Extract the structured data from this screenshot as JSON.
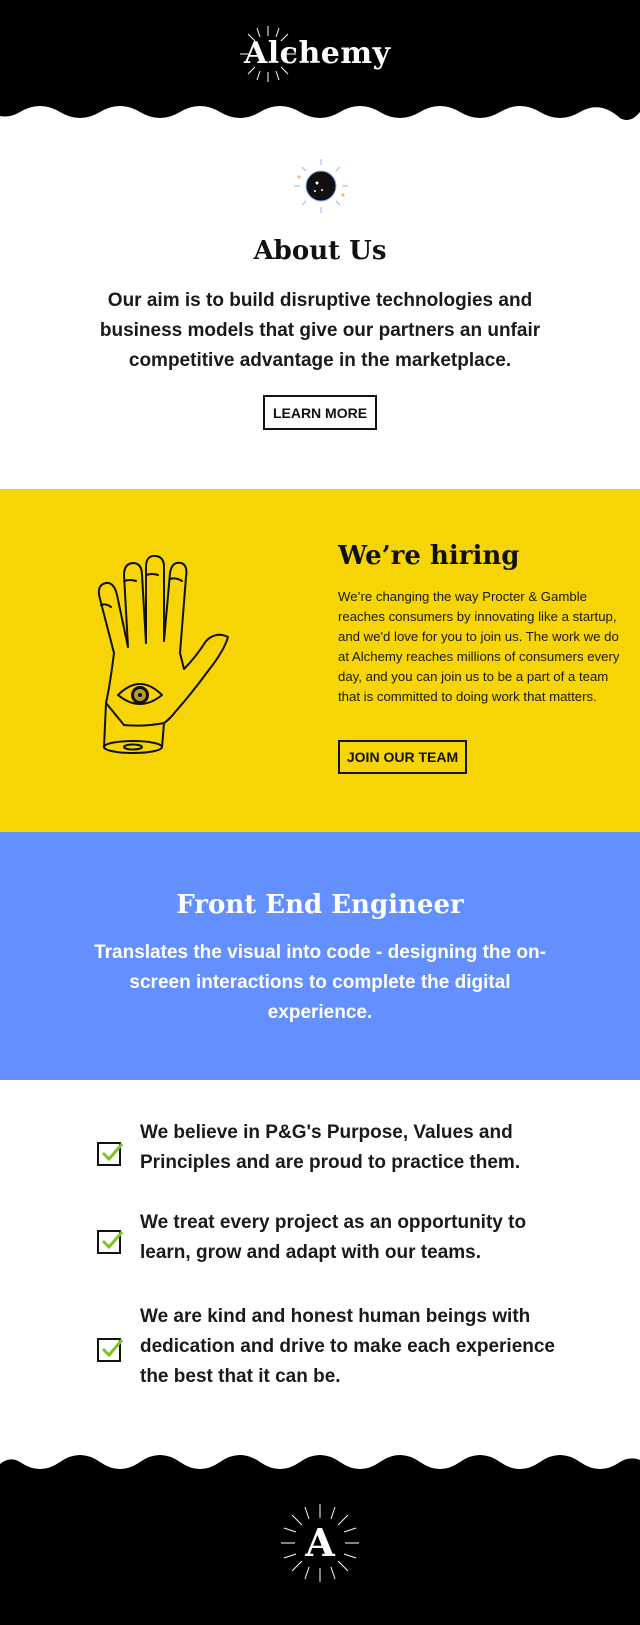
{
  "header": {
    "brand_name": "Alchemy",
    "background_color": "#000000"
  },
  "about": {
    "icon": "moon-icon",
    "title": "About Us",
    "body": "Our aim is to build disruptive technologies and business models that give our partners an unfair competitive advantage in the marketplace.",
    "button_label": "LEARN MORE"
  },
  "hiring": {
    "background_color": "#f7d403",
    "icon": "hand-eye-icon",
    "title": "We’re hiring",
    "body": "We’re changing the way Procter & Gamble reaches consumers by innovating like a startup, and we'd love for you to join us. The work we do at Alchemy reaches millions of consumers every day, and you can join us to be a part of a team that is committed to doing work that matters.",
    "button_label": "JOIN OUR TEAM"
  },
  "engineer": {
    "background_color": "#6490ff",
    "title": "Front End Engineer",
    "body": "Translates the visual into code - designing the on-screen interactions to complete the digital experience."
  },
  "values": {
    "icon": "checkbox-icon",
    "check_color": "#7cc520",
    "items": [
      {
        "text": "We believe in P&G's Purpose, Values and Principles and are proud to practice them."
      },
      {
        "text": "We treat every project as an opportunity to learn, grow and adapt with our teams."
      },
      {
        "text": "We are kind and honest human beings with dedication and drive to make each experience the best that it can be."
      }
    ]
  },
  "footer": {
    "logo_letter": "A",
    "background_color": "#000000"
  }
}
